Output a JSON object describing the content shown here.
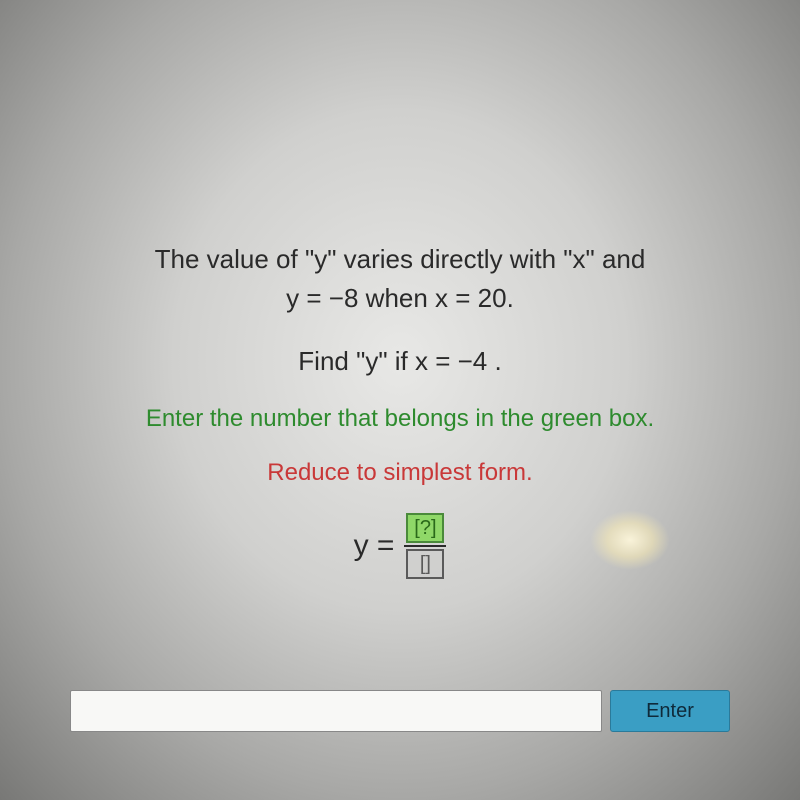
{
  "problem": {
    "line1": "The value of \"y\" varies directly with \"x\" and",
    "line2": "y = −8 when x = 20.",
    "find": "Find \"y\" if x = −4 .",
    "instruction_green": "Enter the number that belongs in the green box.",
    "instruction_red": "Reduce to simplest form."
  },
  "equation": {
    "left": "y =",
    "numerator_placeholder": "?",
    "denominator_placeholder": ""
  },
  "input": {
    "value": "",
    "enter_label": "Enter"
  }
}
